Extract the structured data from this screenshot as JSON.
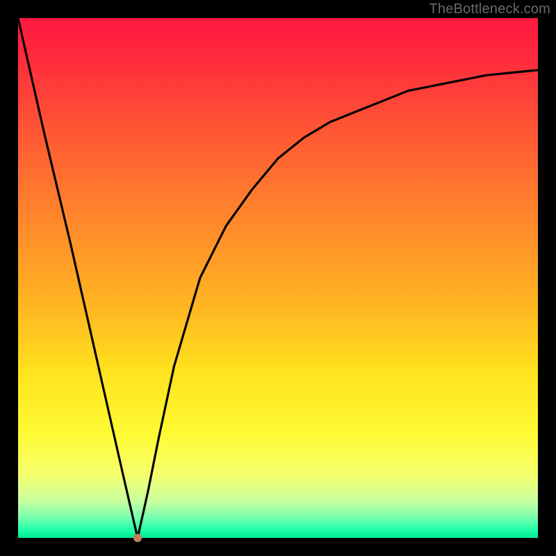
{
  "watermark": "TheBottleneck.com",
  "colors": {
    "frame": "#000000",
    "curve": "#000000",
    "dot": "#c97a5c",
    "gradient_top": "#ff1840",
    "gradient_bottom": "#00e890"
  },
  "chart_data": {
    "type": "line",
    "title": "",
    "xlabel": "",
    "ylabel": "",
    "xlim": [
      0,
      100
    ],
    "ylim": [
      0,
      100
    ],
    "x": [
      0,
      5,
      10,
      15,
      20,
      23,
      25,
      27,
      30,
      35,
      40,
      45,
      50,
      55,
      60,
      65,
      70,
      75,
      80,
      85,
      90,
      95,
      100
    ],
    "values": [
      100,
      78,
      57,
      35,
      13,
      0,
      9,
      19,
      33,
      50,
      60,
      67,
      73,
      77,
      80,
      82,
      84,
      86,
      87,
      88,
      89,
      89.5,
      90
    ],
    "marker": {
      "x": 23,
      "y": 0
    },
    "note": "V-shaped curve reaching 0 at x≈23; right branch rises and asymptotes toward ≈90."
  }
}
